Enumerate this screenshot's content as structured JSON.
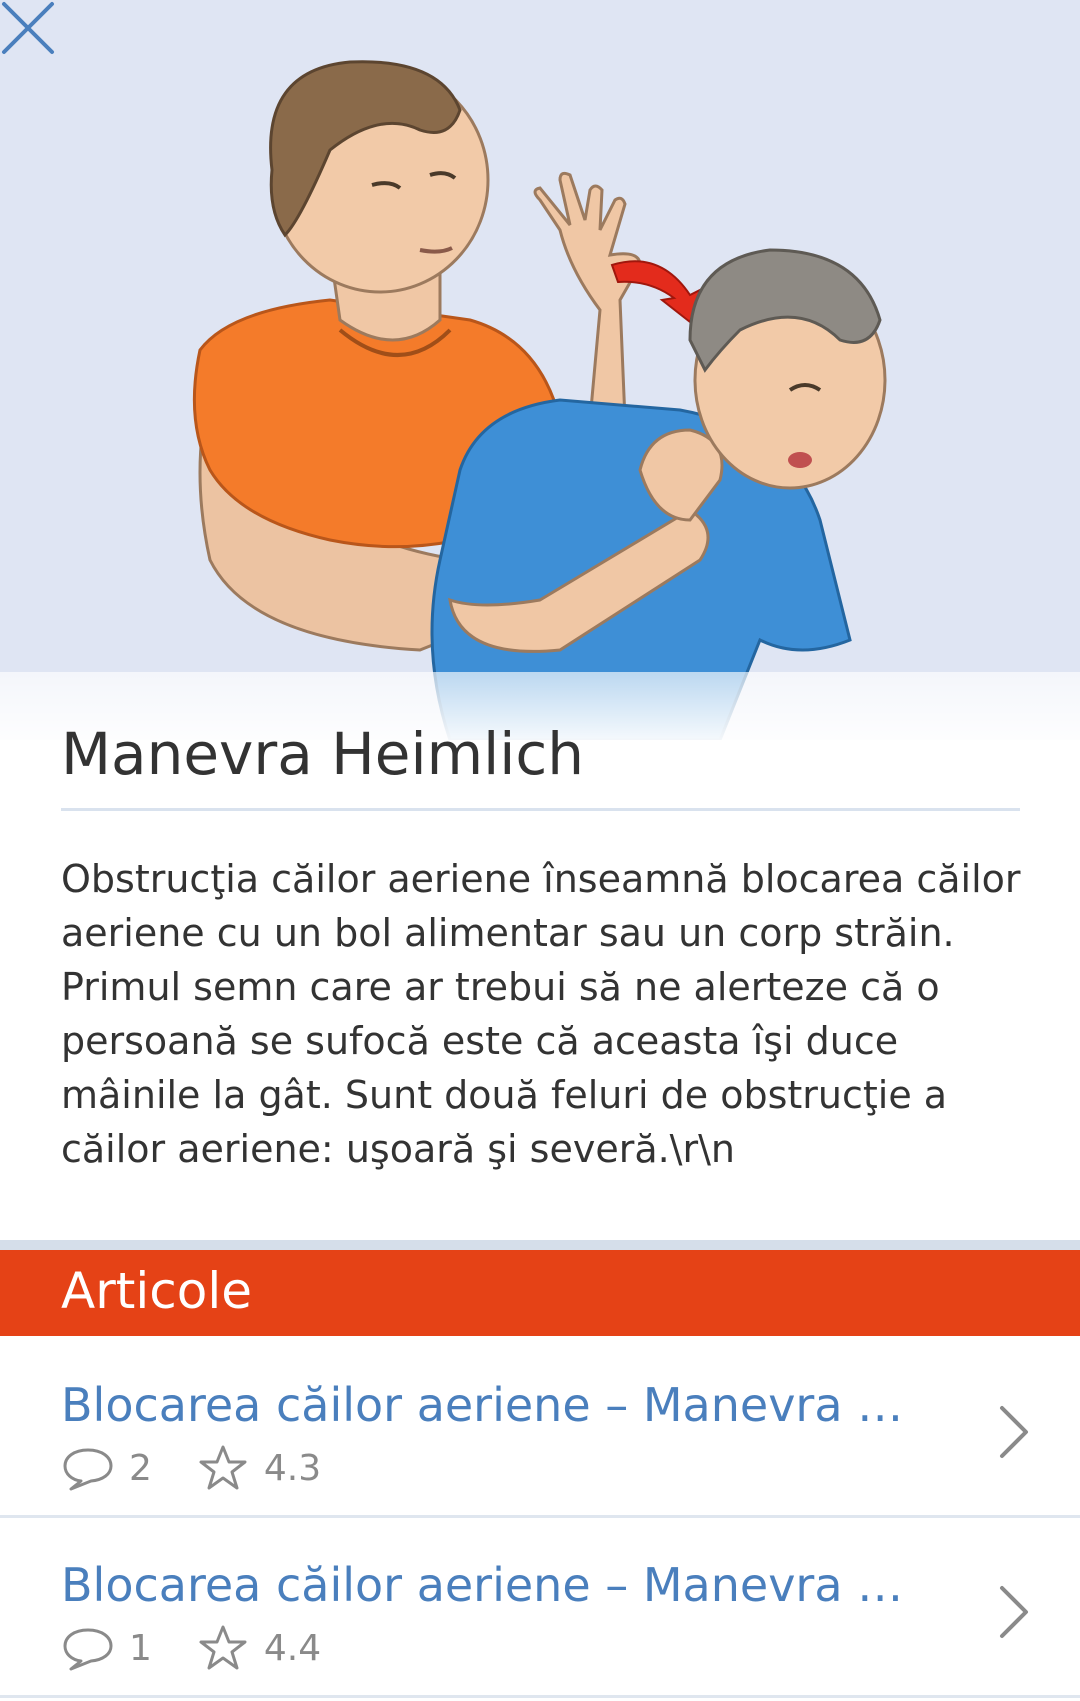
{
  "header": {
    "close_icon": "close-icon"
  },
  "article": {
    "title": "Manevra Heimlich",
    "description": "Obstrucţia căilor aeriene înseamnă blocarea căilor aeriene cu un bol alimentar sau un corp străin. Primul semn care ar trebui să ne alerteze că o persoană se sufocă este că aceasta îşi duce mâinile la gât. Sunt două feluri de obstrucţie a căilor aeriene: uşoară şi severă.\\r\\n"
  },
  "section": {
    "title": "Articole",
    "color": "#e54216"
  },
  "articles": [
    {
      "title": "Blocarea căilor aeriene – Manevra Heimlich",
      "comments": "2",
      "rating": "4.3"
    },
    {
      "title": "Blocarea căilor aeriene – Manevra Heimlich",
      "comments": "1",
      "rating": "4.4"
    }
  ],
  "colors": {
    "accent_blue": "#4a7fbd",
    "hero_background": "#dfe5f3"
  }
}
